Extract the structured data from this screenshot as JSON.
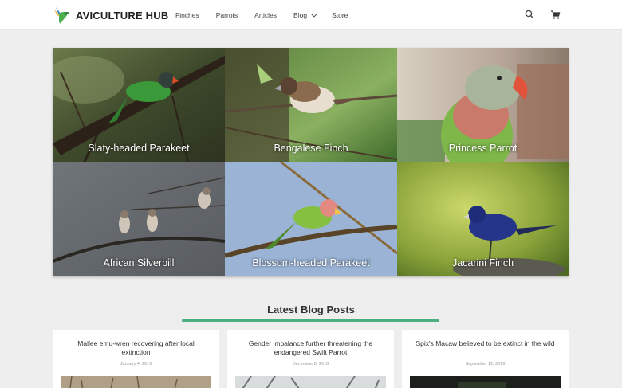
{
  "header": {
    "brand": "AVICULTURE HUB",
    "nav": [
      {
        "label": "Finches"
      },
      {
        "label": "Parrots"
      },
      {
        "label": "Articles"
      },
      {
        "label": "Blog",
        "has_dropdown": true
      },
      {
        "label": "Store"
      }
    ],
    "icons": [
      "search-icon",
      "cart-icon"
    ]
  },
  "gallery": [
    {
      "caption": "Slaty-headed Parakeet"
    },
    {
      "caption": "Bengalese Finch"
    },
    {
      "caption": "Princess Parrot"
    },
    {
      "caption": "African Silverbill"
    },
    {
      "caption": "Blossom-headed Parakeet"
    },
    {
      "caption": "Jacarini Finch"
    }
  ],
  "latest": {
    "title": "Latest Blog Posts",
    "accent_color": "#4caf82",
    "posts": [
      {
        "title": "Mallee emu-wren recovering after local extinction",
        "date": "January 4, 2019"
      },
      {
        "title": "Gender imbalance further threatening the endangered Swift Parrot",
        "date": "December 8, 2018"
      },
      {
        "title": "Spix's Macaw believed to be extinct in the wild",
        "date": "September 12, 2018"
      }
    ]
  }
}
